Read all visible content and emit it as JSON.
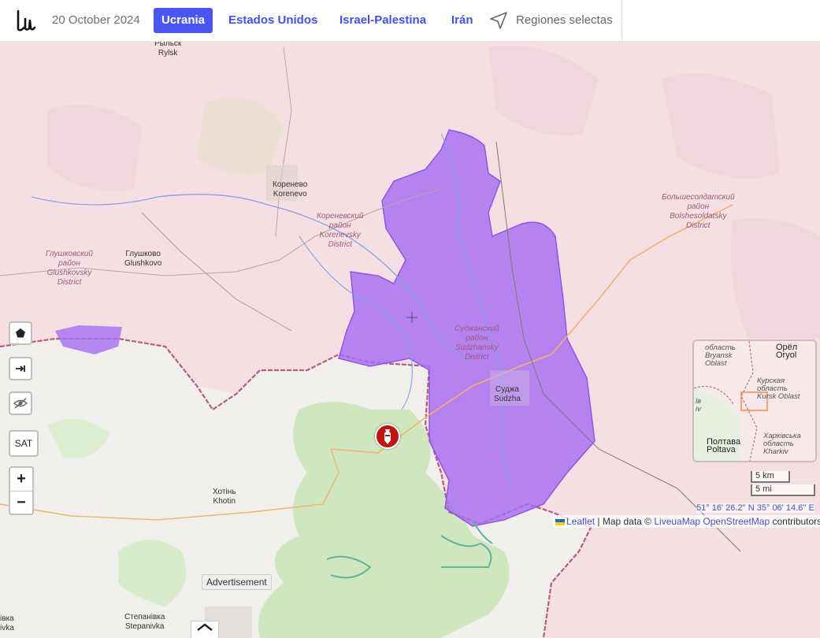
{
  "header": {
    "date": "20 October 2024",
    "tabs": [
      {
        "label": "Ucrania",
        "active": true
      },
      {
        "label": "Estados Unidos",
        "active": false
      },
      {
        "label": "Israel-Palestina",
        "active": false
      },
      {
        "label": "Irán",
        "active": false
      }
    ],
    "regions_label": "Regiones selectas"
  },
  "map": {
    "labels": {
      "rylsk": "Рыльск\nRylsk",
      "korenevo": "Коренево\nKorenevo",
      "korenevsky": "Кореневский\nрайон\nKorenevsky\nDistrict",
      "glushkovo": "Глушково\nGlushkovo",
      "glushkovsky": "Глушковский\nрайон\nGlushkovsky\nDistrict",
      "sudzhansky": "Суджанский\nрайон\nSudzhansky\nDistrict",
      "sudzha": "Суджа\nSudzha",
      "bolshesoldatsky": "Большесолдатский\nрайон\nBolshesoldatsky\nDistrict",
      "khotin": "Хотінь\nKhotin",
      "stepanivka": "Степанівка\nStepanivka",
      "ivka": "івка\nivka"
    },
    "controls": {
      "polygon_icon": "pentagon-icon",
      "measure_icon": "arrow-right-bar-icon",
      "hide_icon": "eye-slash-icon",
      "sat_label": "SAT",
      "zoom_in": "+",
      "zoom_out": "−"
    },
    "minimap": {
      "bryansk": "область\nBryansk\nOblast",
      "oryol": "Орёл\nOryol",
      "kursk": "Курская\nобласть\nKursk Oblast",
      "iv": "ів\niv",
      "poltava": "Полтава\nPoltava",
      "kharkiv": "Харківська\nобласть\nKharkiv"
    },
    "scale_km": "5 km",
    "scale_mi": "5 mi",
    "coordinates": "51° 16' 26.2'' N 35° 06' 14.6'' E",
    "attribution": {
      "leaflet": "Leaflet",
      "sep1": " | Map data © ",
      "livemap": "LiveuaMap",
      "osm": "OpenStreetMap",
      "contributors": " contributors"
    },
    "advertisement": "Advertisement",
    "colors": {
      "occupied_ukraine_zone": "#a66ef2",
      "russia_land": "#f6dfe3",
      "ukraine_land": "#f4f1ee",
      "forest": "#cfe6bf",
      "marker": "#c31212",
      "tab_active": "#4b55f3",
      "tab_link": "#4051ee"
    }
  }
}
